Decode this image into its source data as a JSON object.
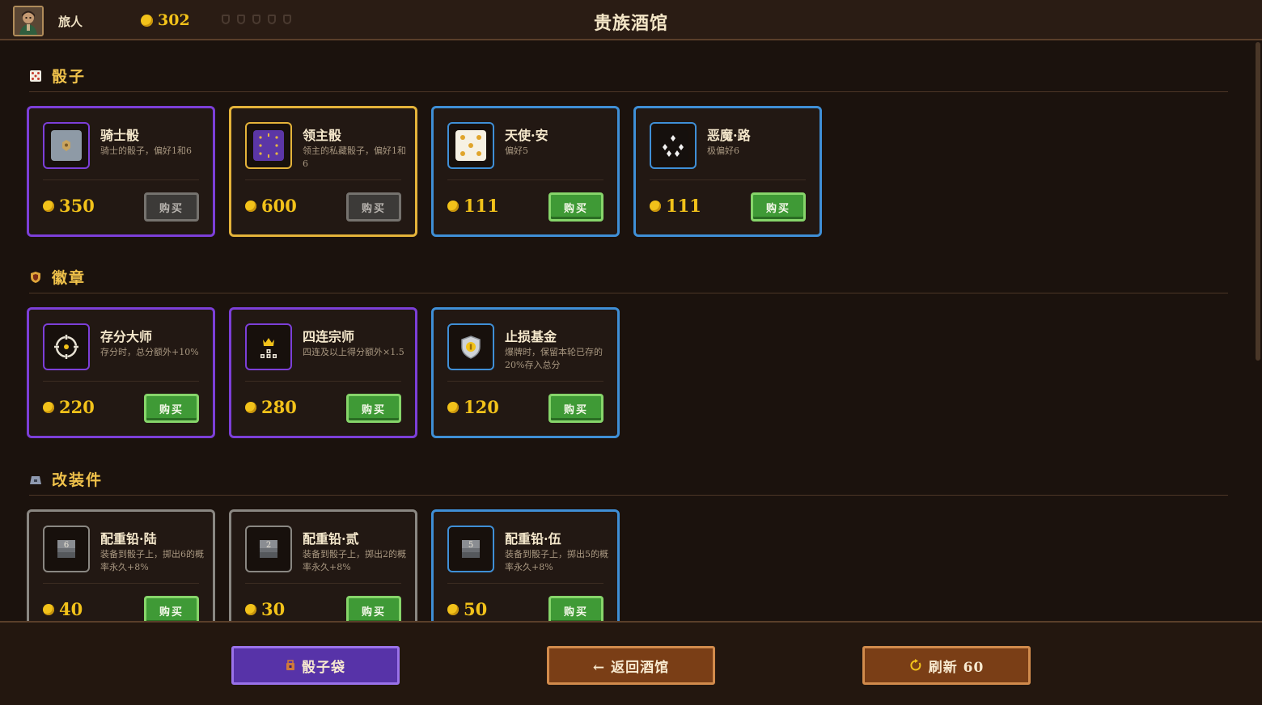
{
  "header": {
    "player_name": "旅人",
    "gold": "302",
    "title": "贵族酒馆",
    "pips_count": 5
  },
  "sections": [
    {
      "title": "骰子",
      "icon": "dice-icon",
      "items": [
        {
          "name": "骑士骰",
          "desc": "骑士的骰子，偏好1和6",
          "price": "350",
          "buy_label": "购买",
          "buy_enabled": false,
          "rarity": "purple",
          "icon": "knight-die-icon"
        },
        {
          "name": "领主骰",
          "desc": "领主的私藏骰子，偏好1和6",
          "price": "600",
          "buy_label": "购买",
          "buy_enabled": false,
          "rarity": "gold",
          "icon": "lord-die-icon"
        },
        {
          "name": "天使·安",
          "desc": "偏好5",
          "price": "111",
          "buy_label": "购买",
          "buy_enabled": true,
          "rarity": "blue",
          "icon": "angel-die-icon"
        },
        {
          "name": "恶魔·路",
          "desc": "极偏好6",
          "price": "111",
          "buy_label": "购买",
          "buy_enabled": true,
          "rarity": "blue",
          "icon": "demon-die-icon"
        }
      ]
    },
    {
      "title": "徽章",
      "icon": "badge-icon",
      "items": [
        {
          "name": "存分大师",
          "desc": "存分时，总分额外+10%",
          "price": "220",
          "buy_label": "购买",
          "buy_enabled": true,
          "rarity": "purple",
          "icon": "target-icon"
        },
        {
          "name": "四连宗师",
          "desc": "四连及以上得分额外×1.5",
          "price": "280",
          "buy_label": "购买",
          "buy_enabled": true,
          "rarity": "purple",
          "icon": "crown-icon"
        },
        {
          "name": "止损基金",
          "desc": "爆牌时，保留本轮已存的20%存入总分",
          "price": "120",
          "buy_label": "购买",
          "buy_enabled": true,
          "rarity": "blue",
          "icon": "shield-icon"
        }
      ]
    },
    {
      "title": "改装件",
      "icon": "weight-icon",
      "items": [
        {
          "name": "配重铅·陆",
          "desc": "装备到骰子上，掷出6的概率永久+8%",
          "price": "40",
          "buy_label": "购买",
          "buy_enabled": true,
          "rarity": "gray",
          "icon": "weight-6-icon",
          "face": "6"
        },
        {
          "name": "配重铅·贰",
          "desc": "装备到骰子上，掷出2的概率永久+8%",
          "price": "30",
          "buy_label": "购买",
          "buy_enabled": true,
          "rarity": "gray",
          "icon": "weight-2-icon",
          "face": "2"
        },
        {
          "name": "配重铅·伍",
          "desc": "装备到骰子上，掷出5的概率永久+8%",
          "price": "50",
          "buy_label": "购买",
          "buy_enabled": true,
          "rarity": "blue",
          "icon": "weight-5-icon",
          "face": "5"
        }
      ]
    }
  ],
  "footer": {
    "bag_label": "骰子袋",
    "back_label": "← 返回酒馆",
    "refresh_label": "刷新 60"
  },
  "colors": {
    "background": "#1b120d",
    "gold": "#f2c21a",
    "section_title": "#f0c24b",
    "rarity_purple": "#7c3fd8",
    "rarity_gold": "#e4b33a",
    "rarity_blue": "#3f8fd6",
    "rarity_gray": "#8a8782",
    "buy_green": "#3f9a36"
  }
}
